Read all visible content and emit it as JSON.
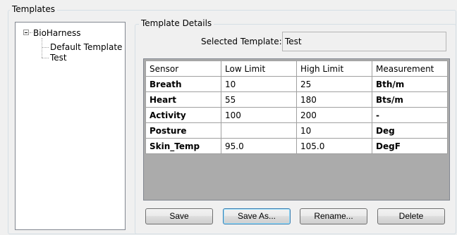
{
  "templates_group": {
    "title": "Templates",
    "tree": {
      "root": "BioHarness",
      "children": [
        "Default Template",
        "Test"
      ],
      "expanded": true
    }
  },
  "details_group": {
    "title": "Template Details",
    "selected_label": "Selected Template:",
    "selected_value": "Test"
  },
  "grid": {
    "columns": [
      "Sensor",
      "Low Limit",
      "High Limit",
      "Measurement"
    ],
    "rows": [
      {
        "sensor": "Breath",
        "low": "10",
        "high": "25",
        "measurement": "Bth/m"
      },
      {
        "sensor": "Heart",
        "low": "55",
        "high": "180",
        "measurement": "Bts/m"
      },
      {
        "sensor": "Activity",
        "low": "100",
        "high": "200",
        "measurement": "-"
      },
      {
        "sensor": "Posture",
        "low": "",
        "high": "10",
        "measurement": "Deg"
      },
      {
        "sensor": "Skin_Temp",
        "low": "95.0",
        "high": "105.0",
        "measurement": "DegF"
      }
    ]
  },
  "buttons": {
    "save": "Save",
    "save_as": "Save As...",
    "rename": "Rename...",
    "delete": "Delete"
  }
}
